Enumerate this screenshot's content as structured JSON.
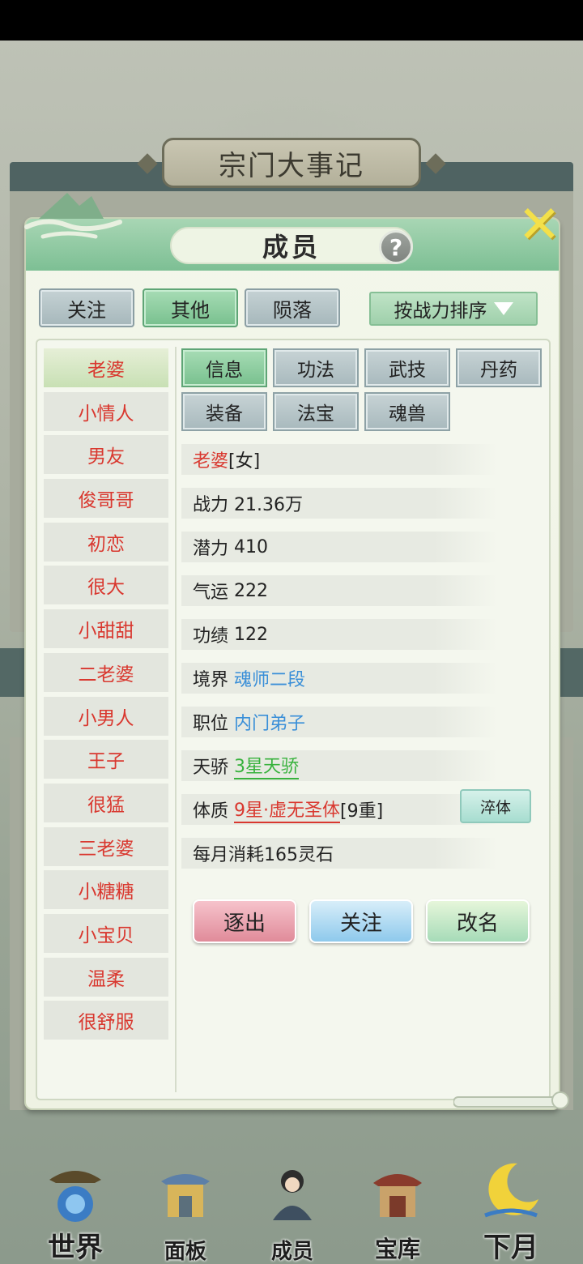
{
  "background": {
    "event_title": "宗门大事记"
  },
  "dialog": {
    "title": "成员",
    "top_tabs": [
      "关注",
      "其他",
      "陨落"
    ],
    "sort_label": "按战力排序",
    "members": [
      "老婆",
      "小情人",
      "男友",
      "俊哥哥",
      "初恋",
      "很大",
      "小甜甜",
      "二老婆",
      "小男人",
      "王子",
      "很猛",
      "三老婆",
      "小糖糖",
      "小宝贝",
      "温柔",
      "很舒服"
    ],
    "sub_tabs": [
      "信息",
      "功法",
      "武技",
      "丹药",
      "装备",
      "法宝",
      "魂兽"
    ],
    "info": {
      "name": "老婆",
      "gender": "[女]",
      "power_label": "战力",
      "power_value": "21.36万",
      "potential_label": "潜力",
      "potential_value": "410",
      "luck_label": "气运",
      "luck_value": "222",
      "merit_label": "功绩",
      "merit_value": "122",
      "realm_label": "境界",
      "realm_value": "魂师二段",
      "position_label": "职位",
      "position_value": "内门弟子",
      "talent_label": "天骄",
      "talent_value": "3星天骄",
      "physique_label": "体质",
      "physique_value": "9星·虚无圣体",
      "physique_level": "[9重]",
      "temper_button": "淬体",
      "monthly_cost": "每月消耗165灵石"
    },
    "actions": {
      "kick": "逐出",
      "follow": "关注",
      "rename": "改名"
    }
  },
  "bottom_nav": [
    "世界",
    "面板",
    "成员",
    "宝库",
    "下月"
  ],
  "colors": {
    "accent_green": "#78c08e",
    "member_red": "#d9382f",
    "link_blue": "#3a8fd8",
    "talent_green": "#38b23d"
  }
}
